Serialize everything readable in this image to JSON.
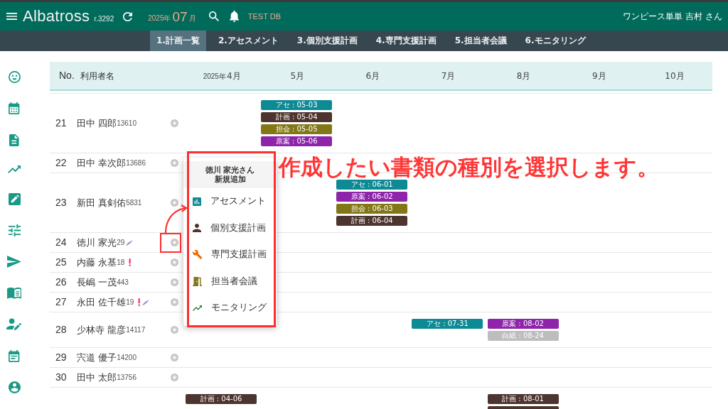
{
  "header": {
    "app_name": "Albatross",
    "version": "r.3292",
    "year": "2025年",
    "month": "07",
    "month_unit": "月",
    "database": "TEST DB",
    "user": "ワンピース単単 吉村 さん"
  },
  "tabs": [
    {
      "label": "1.計画一覧",
      "selected": true
    },
    {
      "label": "2.アセスメント",
      "selected": false
    },
    {
      "label": "3.個別支援計画",
      "selected": false
    },
    {
      "label": "4.専門支援計画",
      "selected": false
    },
    {
      "label": "5.担当者会議",
      "selected": false
    },
    {
      "label": "6.モニタリング",
      "selected": false
    }
  ],
  "table": {
    "columns": [
      "No.",
      "利用者名"
    ],
    "months": [
      {
        "year": "2025年",
        "label": "4月"
      },
      {
        "label": "5月"
      },
      {
        "label": "6月"
      },
      {
        "label": "7月"
      },
      {
        "label": "8月"
      },
      {
        "label": "9月"
      },
      {
        "label": "10月"
      }
    ],
    "rows": [
      {
        "no": "21",
        "name": "田中 四郎",
        "id": "13610",
        "alert": false,
        "tagged": false,
        "highlighted": false,
        "timeline": {
          "column_2": [
            {
              "label": "アセ : 05-03",
              "color": "#0e8a94"
            },
            {
              "label": "計画 : 05-04",
              "color": "#4e342e"
            },
            {
              "label": "担会 : 05-05",
              "color": "#827717"
            },
            {
              "label": "原案 : 05-06",
              "color": "#8e24aa"
            }
          ]
        }
      },
      {
        "no": "22",
        "name": "田中 幸次郎",
        "id": "13686",
        "alert": false,
        "tagged": false,
        "highlighted": false
      },
      {
        "no": "23",
        "name": "新田 真剣佑",
        "id": "5831",
        "alert": false,
        "tagged": false,
        "highlighted": false,
        "timeline": {
          "column_3": [
            {
              "label": "アセ : 06-01",
              "color": "#0e8a94"
            },
            {
              "label": "原案 : 06-02",
              "color": "#8e24aa"
            },
            {
              "label": "担会 : 06-03",
              "color": "#827717"
            },
            {
              "label": "計画 : 06-04",
              "color": "#4e342e"
            }
          ]
        }
      },
      {
        "no": "24",
        "name": "徳川 家光",
        "id": "29",
        "alert": false,
        "tagged": true,
        "highlighted": true
      },
      {
        "no": "25",
        "name": "内藤 永基",
        "id": "18",
        "alert": true,
        "tagged": false,
        "highlighted": false
      },
      {
        "no": "26",
        "name": "長嶋 一茂",
        "id": "443",
        "alert": false,
        "tagged": false,
        "highlighted": false
      },
      {
        "no": "27",
        "name": "永田 佐千雄",
        "id": "19",
        "alert": true,
        "tagged": true,
        "highlighted": false
      },
      {
        "no": "28",
        "name": "少林寺 龍彦",
        "id": "14117",
        "alert": false,
        "tagged": false,
        "highlighted": false,
        "timeline": {
          "column_4": [
            {
              "label": "アセ : 07-31",
              "color": "#0e8a94"
            }
          ],
          "column_5": [
            {
              "label": "原案 : 08-02",
              "color": "#8e24aa"
            },
            {
              "label": "白紙 : 08-24",
              "color": "#bdbdbd"
            }
          ]
        }
      },
      {
        "no": "29",
        "name": "宍道 優子",
        "id": "14200",
        "alert": false,
        "tagged": false,
        "highlighted": false
      },
      {
        "no": "30",
        "name": "田中 太郎",
        "id": "13756",
        "alert": false,
        "tagged": false,
        "highlighted": false
      },
      {
        "alert": false,
        "tagged": false,
        "highlighted": false,
        "timeline": {
          "column_1": [
            {
              "label": "計画 : 04-06",
              "color": "#4e342e"
            }
          ],
          "column_5": [
            {
              "label": "計画 : 08-01",
              "color": "#4e342e"
            },
            {
              "color": "#4e342e"
            }
          ]
        }
      }
    ]
  },
  "menu": {
    "title": "徳川 家光さん",
    "subtitle": "新規追加",
    "items": [
      {
        "kind": "assessment",
        "label": "アセスメント"
      },
      {
        "kind": "plan",
        "label": "個別支援計画"
      },
      {
        "kind": "specialist",
        "label": "専門支援計画"
      },
      {
        "kind": "meeting",
        "label": "担当者会議"
      },
      {
        "kind": "monitoring",
        "label": "モニタリング"
      }
    ]
  },
  "annotation": {
    "text": "作成したい書類の種別を選択します。"
  }
}
